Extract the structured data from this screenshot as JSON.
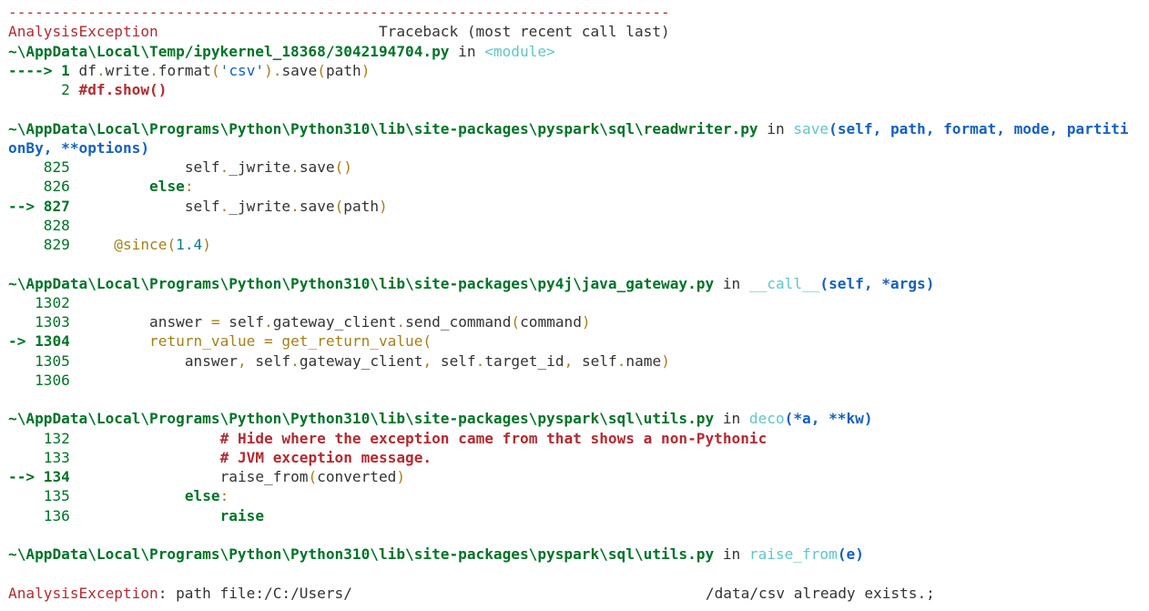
{
  "header": {
    "rule": "---------------------------------------------------------------------------",
    "exc_name": "AnalysisException",
    "gap": "                         ",
    "traceback_title": "Traceback (most recent call last)"
  },
  "frames": [
    {
      "path": "~\\AppData\\Local\\Temp/ipykernel_18368/3042194704.py",
      "in": " in ",
      "func": "<module>",
      "sig": "",
      "lines": [
        {
          "marker": "----> ",
          "num": "1",
          "current": true,
          "code": "df.write.format('csv').save(path)"
        },
        {
          "marker": "      ",
          "num": "2",
          "current": false,
          "code": "#df.show()"
        }
      ]
    },
    {
      "path": "~\\AppData\\Local\\Programs\\Python\\Python310\\lib\\site-packages\\pyspark\\sql\\readwriter.py",
      "in": " in ",
      "func": "save",
      "sig": "(self, path, format, mode, partiti",
      "sig_cont": "onBy, **options)",
      "lines": [
        {
          "marker": "    ",
          "num": "825",
          "current": false,
          "code": "            self._jwrite.save()"
        },
        {
          "marker": "    ",
          "num": "826",
          "current": false,
          "code": "        else:"
        },
        {
          "marker": "--> ",
          "num": "827",
          "current": true,
          "code": "            self._jwrite.save(path)"
        },
        {
          "marker": "    ",
          "num": "828",
          "current": false,
          "code": ""
        },
        {
          "marker": "    ",
          "num": "829",
          "current": false,
          "code": "    @since(1.4)"
        }
      ]
    },
    {
      "path": "~\\AppData\\Local\\Programs\\Python\\Python310\\lib\\site-packages\\py4j\\java_gateway.py",
      "in": " in ",
      "func": "__call__",
      "sig": "(self, *args)",
      "lines": [
        {
          "marker": "   ",
          "num": "1302",
          "current": false,
          "code": ""
        },
        {
          "marker": "   ",
          "num": "1303",
          "current": false,
          "code": "        answer = self.gateway_client.send_command(command)"
        },
        {
          "marker": "-> ",
          "num": "1304",
          "current": true,
          "code": "        return_value = get_return_value("
        },
        {
          "marker": "   ",
          "num": "1305",
          "current": false,
          "code": "            answer, self.gateway_client, self.target_id, self.name)"
        },
        {
          "marker": "   ",
          "num": "1306",
          "current": false,
          "code": ""
        }
      ]
    },
    {
      "path": "~\\AppData\\Local\\Programs\\Python\\Python310\\lib\\site-packages\\pyspark\\sql\\utils.py",
      "in": " in ",
      "func": "deco",
      "sig": "(*a, **kw)",
      "lines": [
        {
          "marker": "    ",
          "num": "132",
          "current": false,
          "code": "                # Hide where the exception came from that shows a non-Pythonic"
        },
        {
          "marker": "    ",
          "num": "133",
          "current": false,
          "code": "                # JVM exception message."
        },
        {
          "marker": "--> ",
          "num": "134",
          "current": true,
          "code": "                raise_from(converted)"
        },
        {
          "marker": "    ",
          "num": "135",
          "current": false,
          "code": "            else:"
        },
        {
          "marker": "    ",
          "num": "136",
          "current": false,
          "code": "                raise"
        }
      ]
    },
    {
      "path": "~\\AppData\\Local\\Programs\\Python\\Python310\\lib\\site-packages\\pyspark\\sql\\utils.py",
      "in": " in ",
      "func": "raise_from",
      "sig": "(e)",
      "lines": []
    }
  ],
  "final_error": {
    "exc_name": "AnalysisException",
    "sep": ": ",
    "msg_start": "path file:/C:/Users/",
    "msg_end": "/data/csv already exists.;"
  },
  "colors": {
    "error_red": "#b22b31",
    "path_green": "#007427",
    "func_cyan": "#60c6c8",
    "sig_blue": "#1461c1",
    "text": "#333333"
  }
}
